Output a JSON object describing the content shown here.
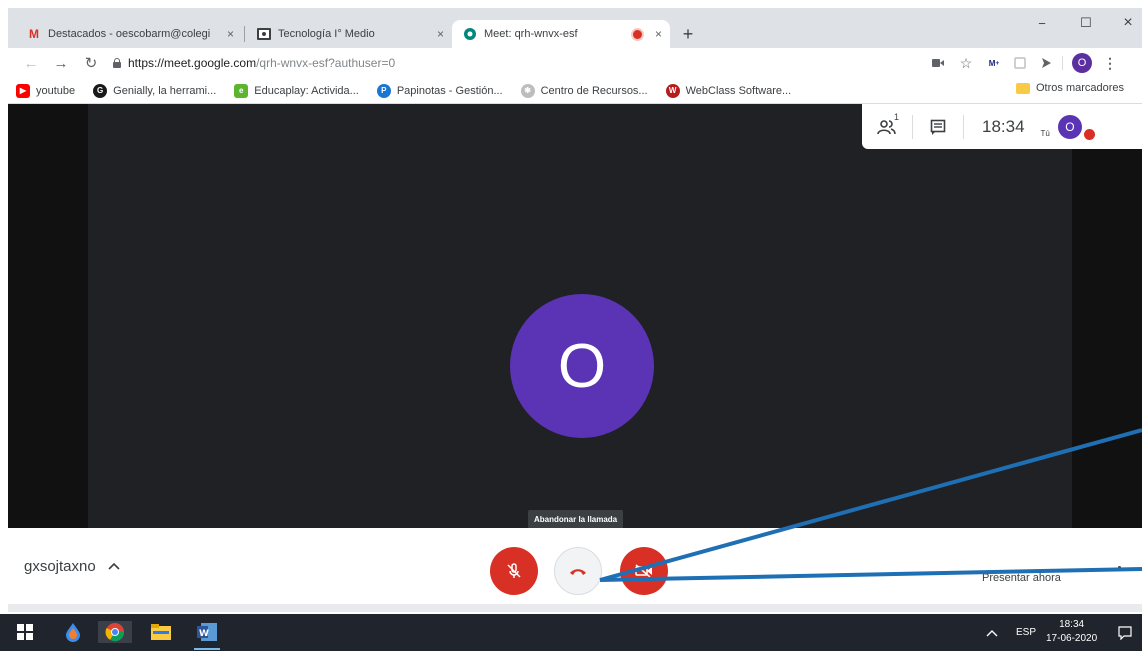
{
  "tabs": [
    {
      "title": "Destacados - oescobarm@colegi",
      "icon": "gmail-icon",
      "close": "×"
    },
    {
      "title": "Tecnología I° Medio",
      "icon": "classroom-icon",
      "close": "×"
    },
    {
      "title": "Meet: qrh-wnvx-esf",
      "icon": "meet-icon",
      "close": "×",
      "active": true
    }
  ],
  "window_controls": {
    "minimize": "−",
    "maximize": "☐",
    "close": "×"
  },
  "new_tab": "+",
  "omnibar": {
    "url_host": "https://meet.google.com",
    "url_path": "/qrh-wnvx-esf?authuser=0",
    "profile_initial": "O"
  },
  "bookmarks": [
    {
      "label": "youtube",
      "color": "#ff0000"
    },
    {
      "label": "Genially, la herrami...",
      "color": "#1a1a1a"
    },
    {
      "label": "Educaplay: Activida...",
      "color": "#5bb52e"
    },
    {
      "label": "Papinotas - Gestión...",
      "color": "#1976d2"
    },
    {
      "label": "Centro de Recursos...",
      "color": "#9e9e9e"
    },
    {
      "label": "WebClass Software...",
      "color": "#b71c1c"
    }
  ],
  "bookmarks_other": "Otros marcadores",
  "meet": {
    "participant_initial": "O",
    "participants_count": "1",
    "time": "18:34",
    "self_label": "Tú",
    "self_initial": "O",
    "tooltip": "Abandonar la llamada",
    "meeting_code": "gxsojtaxno",
    "present_label": "Presentar ahora",
    "accent": "#5b34b5",
    "danger": "#d93025"
  },
  "taskbar": {
    "lang": "ESP",
    "time": "18:34",
    "date": "17-06-2020"
  }
}
